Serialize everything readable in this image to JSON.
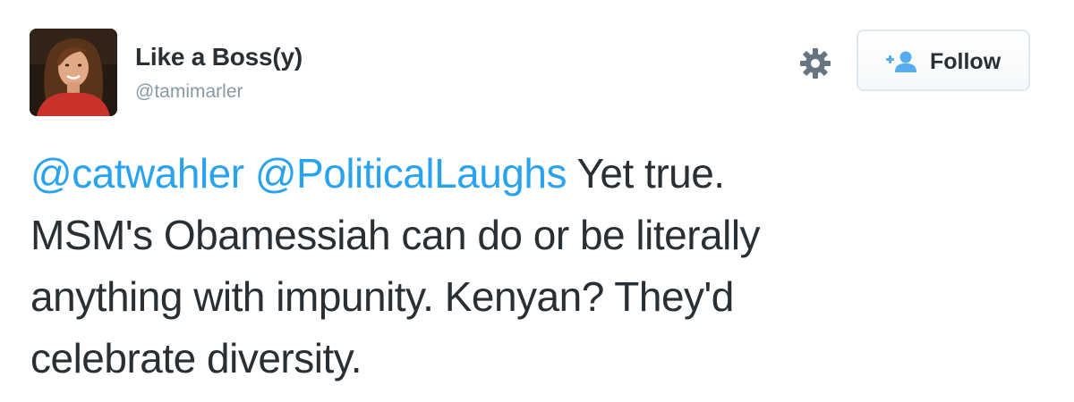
{
  "author": {
    "display_name": "Like a Boss(y)",
    "handle": "@tamimarler"
  },
  "actions": {
    "follow_label": "Follow",
    "settings_icon": "gear-icon",
    "follow_icon": "add-user-icon"
  },
  "tweet": {
    "mentions": [
      "@catwahler",
      "@PoliticalLaughs"
    ],
    "line1_text": "Yet true.",
    "line2": "MSM's Obamessiah can do or be literally",
    "line3": "anything with impunity. Kenyan? They'd",
    "line4": "celebrate diversity."
  },
  "colors": {
    "text": "#292f33",
    "muted": "#8899a6",
    "link": "#2aa3ef",
    "border": "#e1e8ed"
  }
}
